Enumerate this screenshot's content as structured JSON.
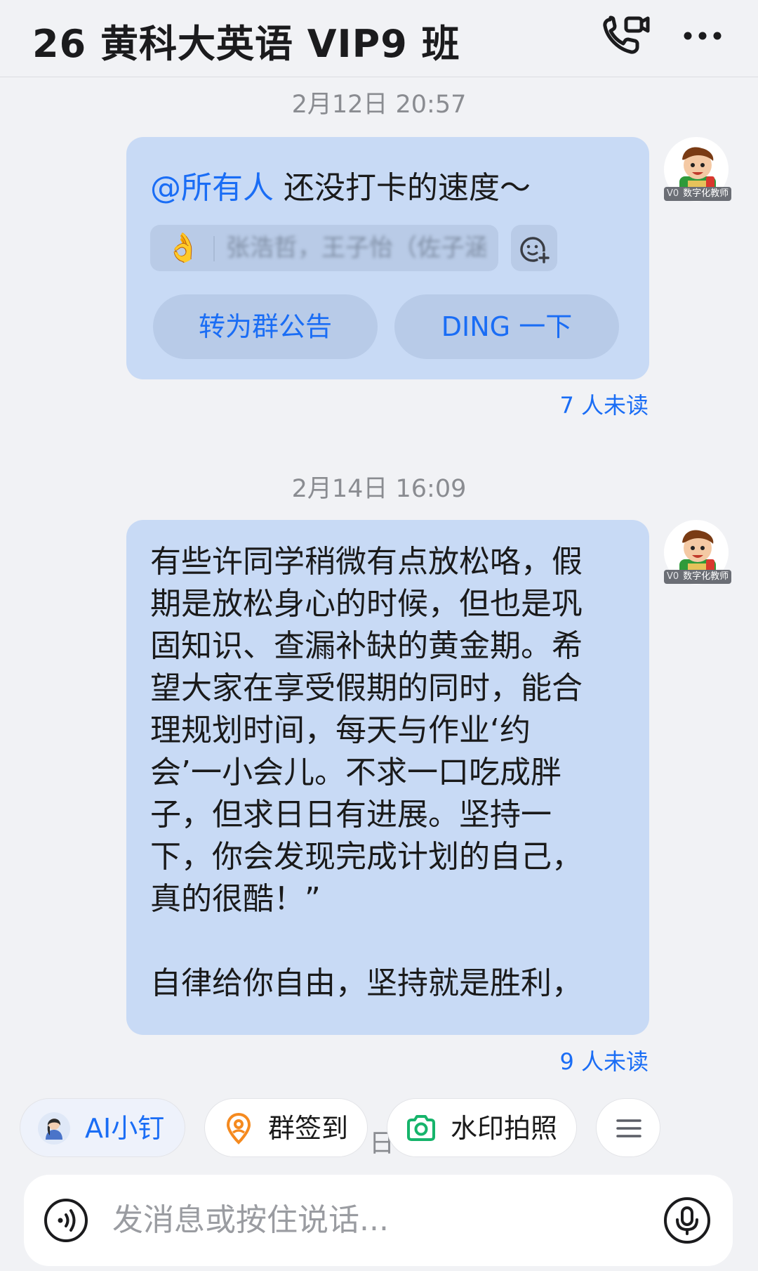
{
  "header": {
    "title": "26 黄科大英语 VIP9 班",
    "call_icon": "video-call-icon",
    "more_icon": "more-icon"
  },
  "messages": [
    {
      "timestamp": "2月12日 20:57",
      "mention": "@所有人",
      "text": " 还没打卡的速度～",
      "reaction_emoji": "👌",
      "reaction_blurred_text": "张浩哲，王子怡（佐子涵）",
      "actions": [
        "转为群公告",
        "DING 一下"
      ],
      "unread": "7 人未读"
    },
    {
      "timestamp": "2月14日 16:09",
      "text": "有些许同学稍微有点放松咯，假\n期是放松身心的时候，但也是巩\n固知识、查漏补缺的黄金期。希\n望大家在享受假期的同时，能合\n理规划时间，每天与作业‘约\n会’一小会儿。不求一口吃成胖\n子，但求日日有进展。坚持一\n下，你会发现完成计划的自己，\n真的很酷！”\n\n自律给你自由，坚持就是胜利，",
      "unread": "9 人未读"
    }
  ],
  "avatar": {
    "prefix": "V0",
    "label": "数字化教师"
  },
  "quick_actions": [
    {
      "label": "AI小钉",
      "icon": "ai-assistant-avatar-icon"
    },
    {
      "label": "群签到",
      "icon": "location-pin-icon"
    },
    {
      "label": "水印拍照",
      "icon": "camera-icon"
    },
    {
      "label": "",
      "icon": "menu-icon"
    }
  ],
  "peek_char": "日",
  "input": {
    "placeholder": "发消息或按住说话...",
    "voice_icon": "voice-mode-icon",
    "mic_icon": "microphone-icon"
  },
  "colors": {
    "accent": "#1a6df5",
    "bubble": "#c8daf5",
    "background": "#f1f2f5",
    "sign_icon": "#f58a1f",
    "camera_icon": "#16b46b"
  }
}
